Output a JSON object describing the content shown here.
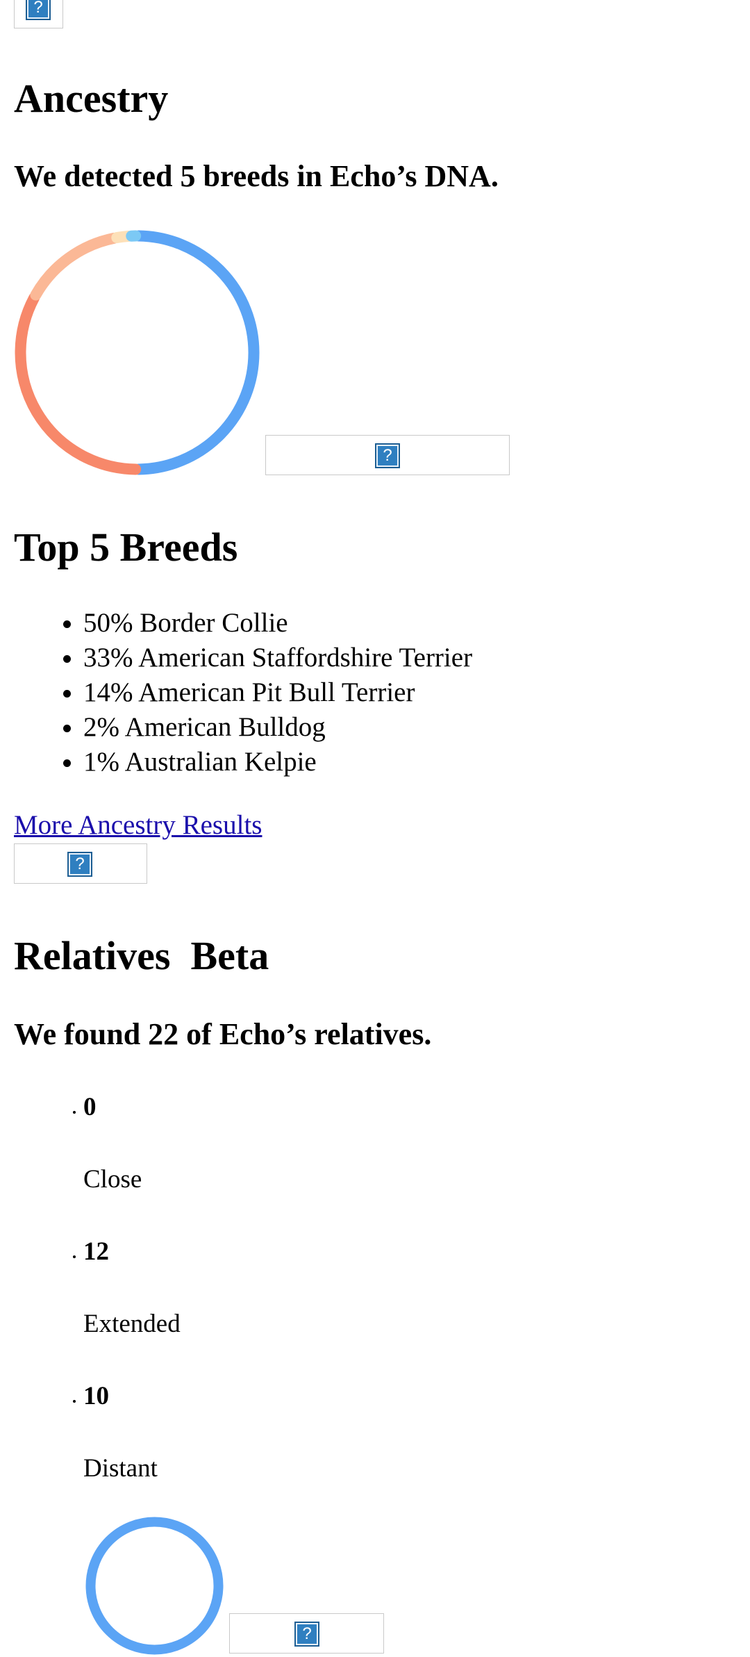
{
  "ancestry": {
    "title": "Ancestry",
    "summary": "We detected 5 breeds in Echo’s DNA.",
    "donut": [
      {
        "label": "Border Collie",
        "percent": 50,
        "color": "#5ba4f5"
      },
      {
        "label": "American Staffordshire Terrier",
        "percent": 33,
        "color": "#f7886a"
      },
      {
        "label": "American Pit Bull Terrier",
        "percent": 14,
        "color": "#fbb896"
      },
      {
        "label": "American Bulldog",
        "percent": 2,
        "color": "#fde0b8"
      },
      {
        "label": "Australian Kelpie",
        "percent": 1,
        "color": "#7cc9f5"
      }
    ],
    "top_breeds_title": "Top 5 Breeds",
    "top_breeds": [
      "50% Border Collie",
      "33% American Staffordshire Terrier",
      "14% American Pit Bull Terrier",
      "2% American Bulldog",
      "1% Australian Kelpie"
    ],
    "more_link": "More Ancestry Results"
  },
  "relatives": {
    "title": "Relatives  Beta",
    "summary": "We found 22 of Echo’s relatives.",
    "groups": [
      {
        "count": "0",
        "label": "Close"
      },
      {
        "count": "12",
        "label": "Extended"
      },
      {
        "count": "10",
        "label": "Distant"
      }
    ],
    "ring_color": "#5ba4f5"
  },
  "icons": {
    "broken_image": "broken-image-icon",
    "glyph": "?"
  }
}
